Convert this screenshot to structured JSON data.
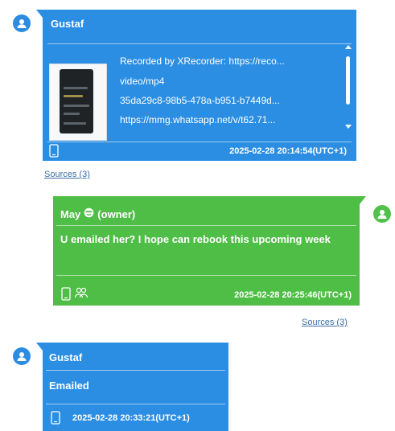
{
  "messages": [
    {
      "sender": "Gustaf",
      "attachment": {
        "lines": [
          "Recorded by XRecorder: https://reco...",
          "video/mp4",
          "35da29c8-98b5-478a-b951-b7449d...",
          "https://mmg.whatsapp.net/v/t62.71..."
        ]
      },
      "timestamp": "2025-02-28 20:14:54(UTC+1)",
      "sources": "Sources (3)"
    },
    {
      "sender": "May",
      "sender_role": "(owner)",
      "text": "U emailed her? I hope can rebook this upcoming week",
      "timestamp": "2025-02-28 20:25:46(UTC+1)",
      "sources": "Sources (3)"
    },
    {
      "sender": "Gustaf",
      "text": "Emailed",
      "timestamp": "2025-02-28 20:33:21(UTC+1)"
    }
  ],
  "colors": {
    "incoming_bubble": "#2b8ee3",
    "outgoing_bubble": "#4fbe46",
    "link": "#3a6ea5"
  },
  "icons": [
    "user-avatar-icon",
    "phone-icon",
    "group-icon",
    "emoji-icon"
  ]
}
